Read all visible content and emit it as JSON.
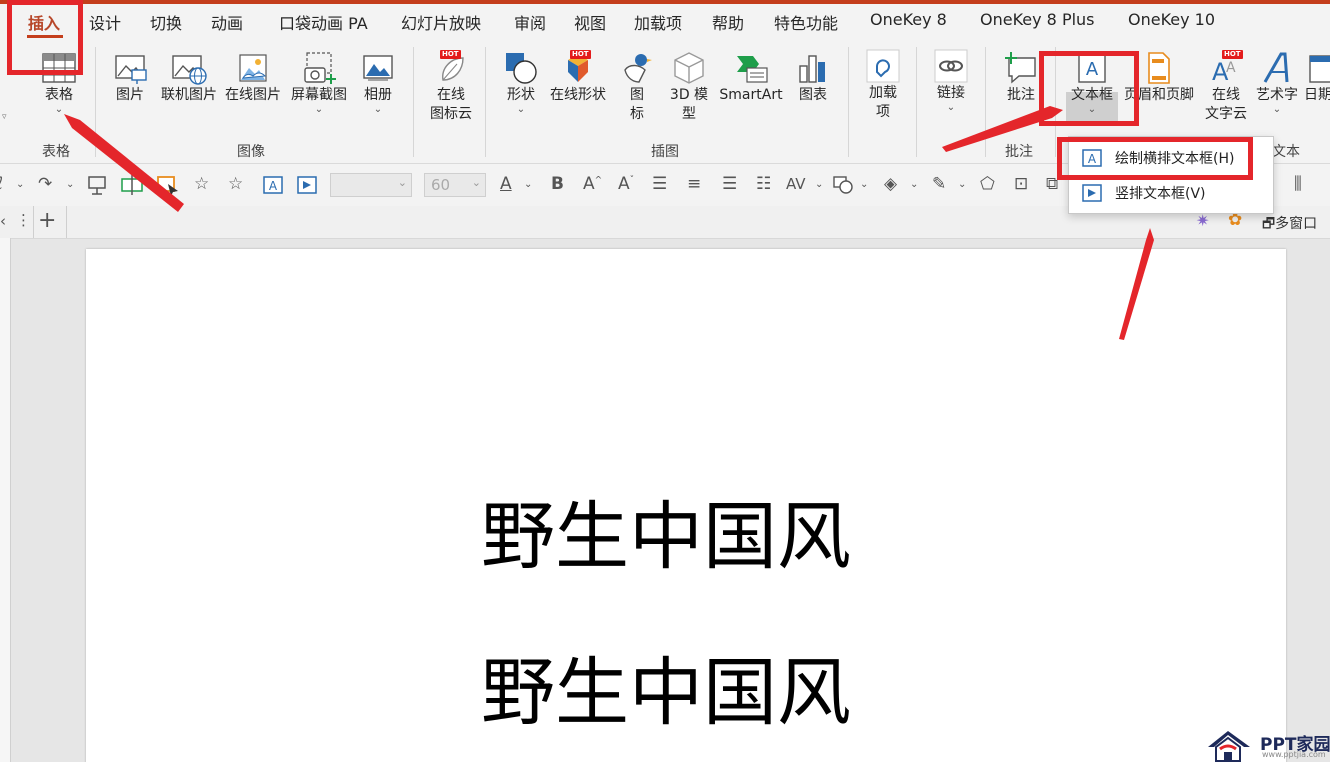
{
  "tabs": [
    "插入",
    "设计",
    "切换",
    "动画",
    "口袋动画 PA",
    "幻灯片放映",
    "审阅",
    "视图",
    "加载项",
    "帮助",
    "特色功能",
    "OneKey 8",
    "OneKey 8 Plus",
    "OneKey 10"
  ],
  "ribbon": {
    "table": {
      "label": "表格",
      "group": "表格"
    },
    "images": {
      "picture": "图片",
      "online_picture": "联机图片",
      "online_picture2": "在线图片",
      "screenshot": "屏幕截图",
      "album": "相册",
      "group": "图像"
    },
    "iconcloud": {
      "line1": "在线",
      "line2": "图标云"
    },
    "illustrations": {
      "shapes": "形状",
      "online_shapes": "在线形状",
      "icons1": "图",
      "icons2": "标",
      "model1": "3D 模",
      "model2": "型",
      "smartart": "SmartArt",
      "chart": "图表",
      "group": "插图"
    },
    "addin": {
      "line1": "加载",
      "line2": "项"
    },
    "link": {
      "label": "链接"
    },
    "comment": {
      "label": "批注",
      "group": "批注"
    },
    "textbox": {
      "label": "文本框"
    },
    "header_footer": {
      "label": "页眉和页脚"
    },
    "wordcloud": {
      "line1": "在线",
      "line2": "文字云"
    },
    "wordart": {
      "label": "艺术字"
    },
    "date": {
      "label": "日期"
    },
    "text_group_partial": "文本",
    "hot": "HOT"
  },
  "format_bar": {
    "font_size": "60",
    "bold": "B"
  },
  "doc_strip": {
    "multiwindow": "多窗口"
  },
  "dropdown": {
    "horizontal": "绘制横排文本框(H)",
    "vertical": "竖排文本框(V)"
  },
  "slide": {
    "line1": "野生中国风",
    "line2": "野生中国风"
  },
  "watermark": {
    "brand": "PPT家园",
    "url": "www.pptjia.com"
  },
  "colors": {
    "accent": "#c43e1c",
    "highlight": "#e4262b",
    "icon_blue": "#2b6cb0"
  }
}
